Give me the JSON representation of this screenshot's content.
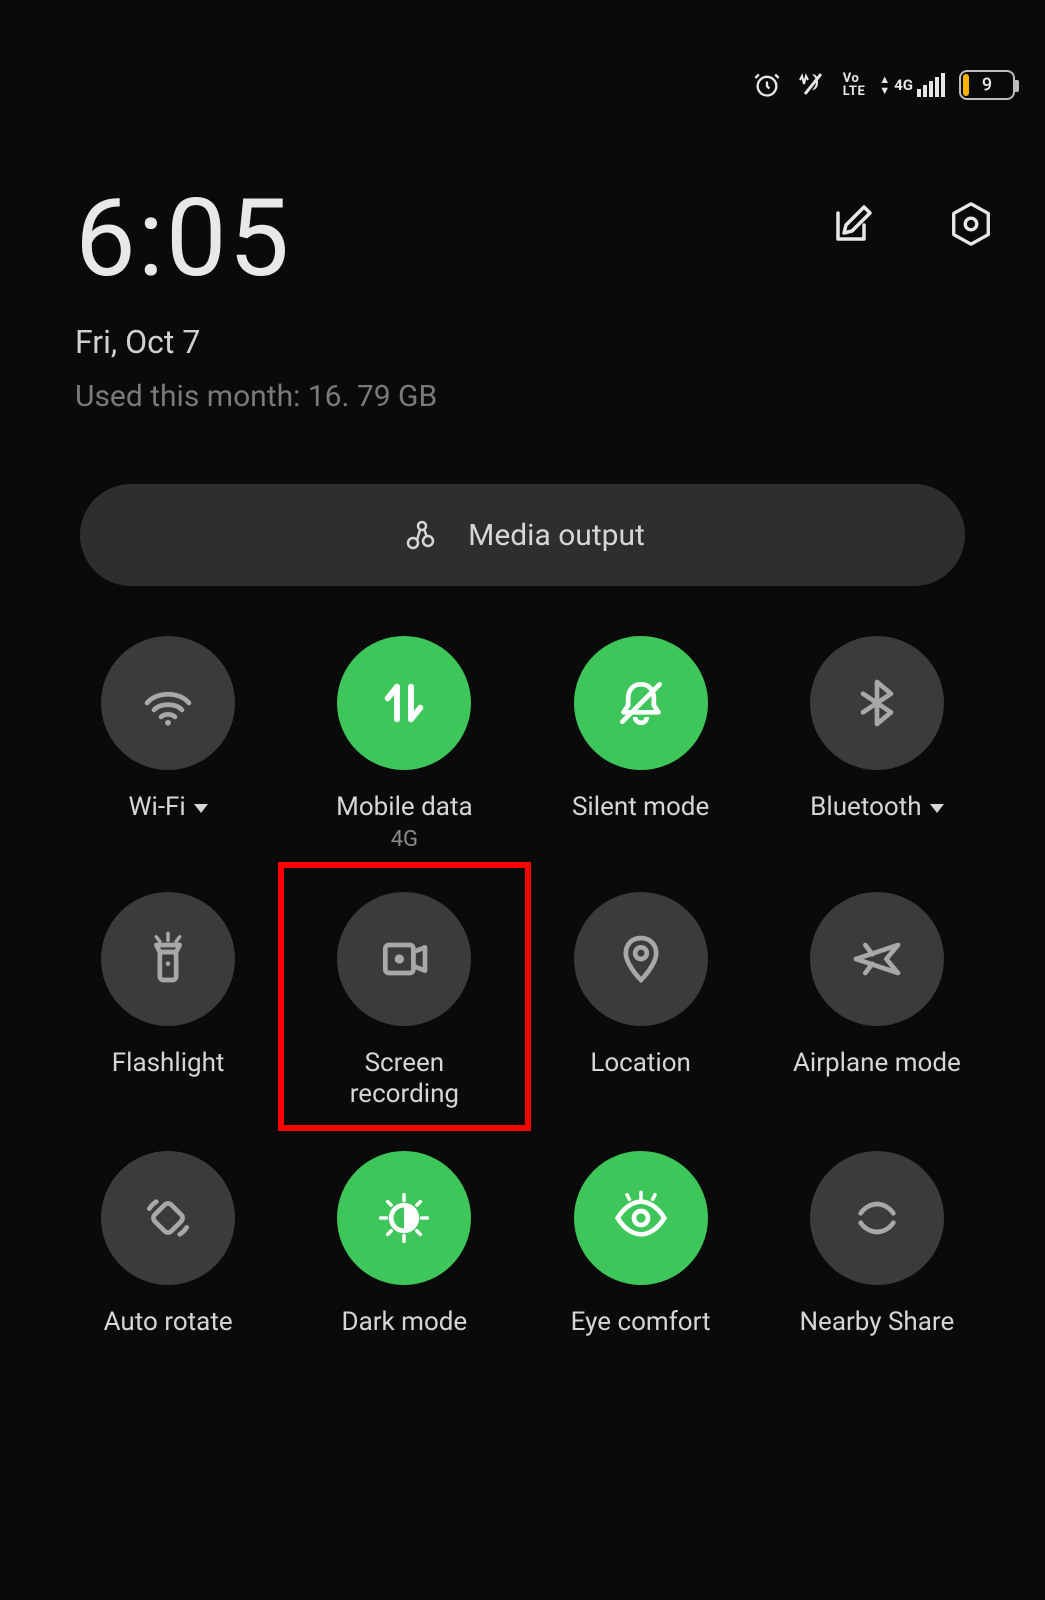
{
  "status_bar": {
    "volte": "Vo\nLTE",
    "signal_label": "4G",
    "battery_percent": "9"
  },
  "header": {
    "time": "6:05",
    "date": "Fri,  Oct 7",
    "usage_prefix": "Used this month:",
    "usage_value": "16. 79 GB"
  },
  "media_output_label": "Media output",
  "tiles": [
    {
      "label": "Wi-Fi",
      "sublabel": "",
      "active": false,
      "icon": "wifi",
      "has_dropdown": true
    },
    {
      "label": "Mobile data",
      "sublabel": "4G",
      "active": true,
      "icon": "mobile-data",
      "has_dropdown": false
    },
    {
      "label": "Silent mode",
      "sublabel": "",
      "active": true,
      "icon": "bell-off",
      "has_dropdown": false
    },
    {
      "label": "Bluetooth",
      "sublabel": "",
      "active": false,
      "icon": "bluetooth",
      "has_dropdown": true
    },
    {
      "label": "Flashlight",
      "sublabel": "",
      "active": false,
      "icon": "flashlight",
      "has_dropdown": false
    },
    {
      "label": "Screen recording",
      "sublabel": "",
      "active": false,
      "icon": "screen-record",
      "has_dropdown": false
    },
    {
      "label": "Location",
      "sublabel": "",
      "active": false,
      "icon": "location",
      "has_dropdown": false
    },
    {
      "label": "Airplane mode",
      "sublabel": "",
      "active": false,
      "icon": "airplane",
      "has_dropdown": false
    },
    {
      "label": "Auto rotate",
      "sublabel": "",
      "active": false,
      "icon": "rotate",
      "has_dropdown": false
    },
    {
      "label": "Dark mode",
      "sublabel": "",
      "active": true,
      "icon": "dark-mode",
      "has_dropdown": false
    },
    {
      "label": "Eye comfort",
      "sublabel": "",
      "active": true,
      "icon": "eye",
      "has_dropdown": false
    },
    {
      "label": "Nearby Share",
      "sublabel": "",
      "active": false,
      "icon": "nearby",
      "has_dropdown": false
    }
  ],
  "highlight_index": 5,
  "colors": {
    "active": "#3ec65a",
    "inactive": "#3b3b3b",
    "highlight": "#ff0000"
  }
}
